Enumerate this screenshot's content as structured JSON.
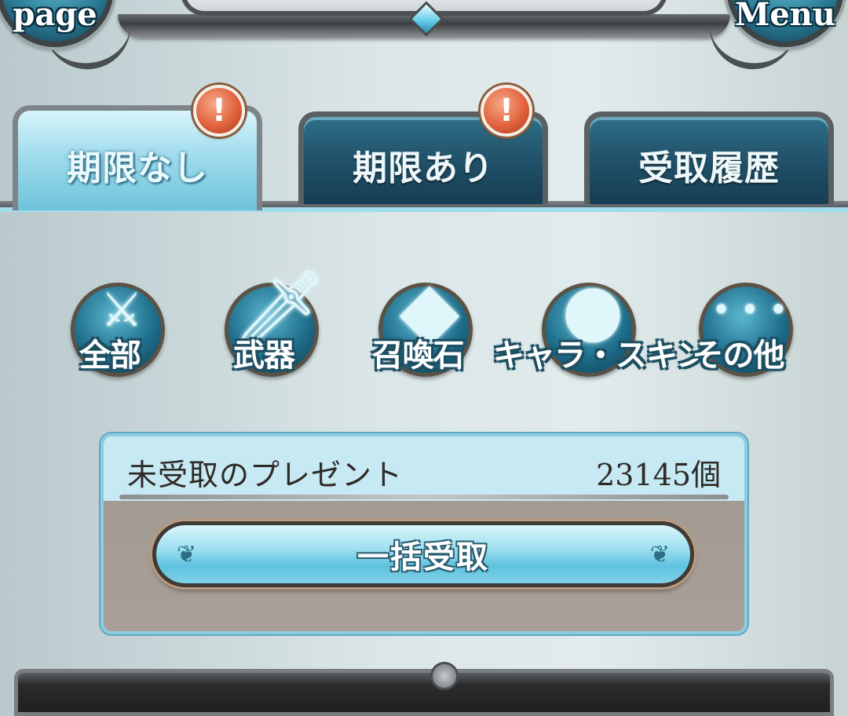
{
  "header": {
    "left_button_label": "page",
    "right_button_label": "Menu"
  },
  "tabs": [
    {
      "label": "期限なし",
      "active": true,
      "badge": "!"
    },
    {
      "label": "期限あり",
      "active": false,
      "badge": "!"
    },
    {
      "label": "受取履歴",
      "active": false,
      "badge": ""
    }
  ],
  "categories": [
    {
      "label": "全部",
      "icon": "all-items-icon"
    },
    {
      "label": "武器",
      "icon": "sword-icon"
    },
    {
      "label": "召喚石",
      "icon": "crystal-icon"
    },
    {
      "label": "キャラ・スキン",
      "icon": "character-icon"
    },
    {
      "label": "その他",
      "icon": "more-icon"
    }
  ],
  "present_panel": {
    "title": "未受取のプレゼント",
    "count": "23145個",
    "claim_all_label": "一括受取"
  },
  "colors": {
    "accent": "#6fc3db",
    "badge": "#e2633d",
    "frame": "#5a5f62"
  }
}
